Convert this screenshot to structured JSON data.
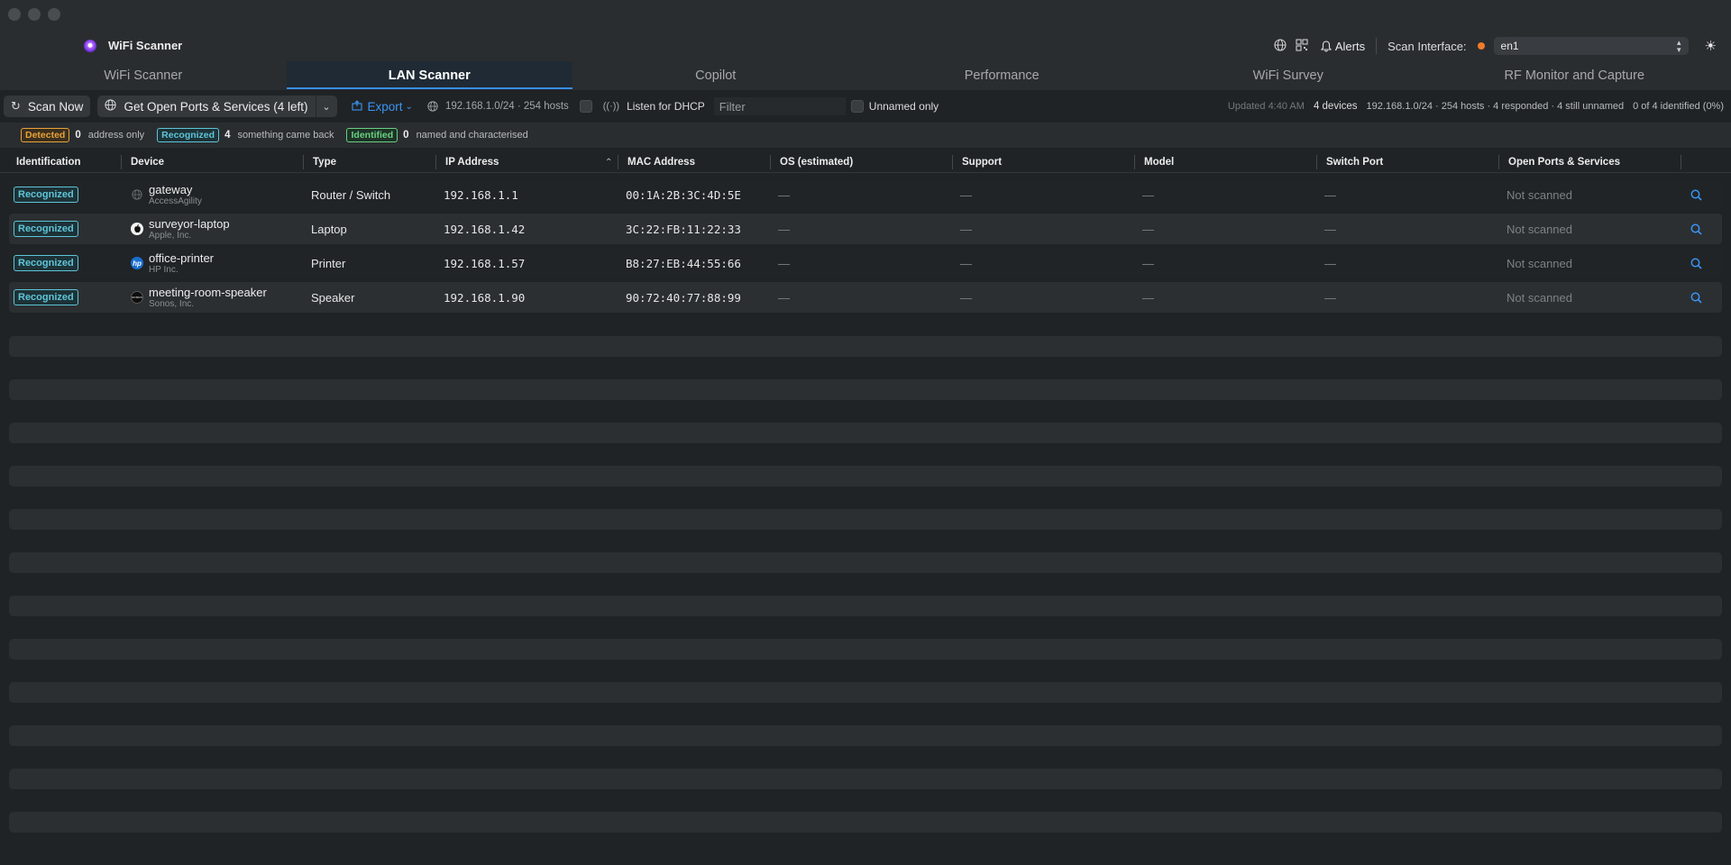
{
  "window": {
    "title": "WiFi Scanner"
  },
  "toolbar_right": {
    "alerts_label": "Alerts",
    "scan_interface_label": "Scan Interface:",
    "interface_value": "en1",
    "status_color": "#f07b2a"
  },
  "tabs": [
    {
      "label": "WiFi Scanner",
      "active": false
    },
    {
      "label": "LAN Scanner",
      "active": true
    },
    {
      "label": "Copilot",
      "active": false
    },
    {
      "label": "Performance",
      "active": false
    },
    {
      "label": "WiFi Survey",
      "active": false
    },
    {
      "label": "RF Monitor and Capture",
      "active": false
    }
  ],
  "toolbar": {
    "scan_now": "Scan Now",
    "open_ports": "Get Open Ports & Services (4 left)",
    "export": "Export",
    "network": "192.168.1.0/24 · 254 hosts",
    "listen_dhcp": "Listen for DHCP",
    "filter_placeholder": "Filter",
    "unnamed_only": "Unnamed only",
    "updated": "Updated 4:40 AM",
    "devices": "4 devices",
    "summary": "192.168.1.0/24 · 254 hosts · 4 responded · 4 still unnamed",
    "identified_ratio": "0 of 4 identified (0%)"
  },
  "legend": [
    {
      "badge": "Detected",
      "count": "0",
      "desc": "address only"
    },
    {
      "badge": "Recognized",
      "count": "4",
      "desc": "something came back"
    },
    {
      "badge": "Identified",
      "count": "0",
      "desc": "named and characterised"
    }
  ],
  "columns": [
    "Identification",
    "Device",
    "Type",
    "IP Address",
    "MAC Address",
    "OS (estimated)",
    "Support",
    "Model",
    "Switch Port",
    "Open Ports & Services"
  ],
  "rows": [
    {
      "identification": "Recognized",
      "device": "gateway",
      "vendor": "AccessAgility",
      "icon": "globe-icon",
      "type": "Router / Switch",
      "ip": "192.168.1.1",
      "mac": "00:1A:2B:3C:4D:5E",
      "os": "—",
      "support": "—",
      "model": "—",
      "switch_port": "—",
      "ports": "Not scanned"
    },
    {
      "identification": "Recognized",
      "device": "surveyor-laptop",
      "vendor": "Apple, Inc.",
      "icon": "apple-icon",
      "type": "Laptop",
      "ip": "192.168.1.42",
      "mac": "3C:22:FB:11:22:33",
      "os": "—",
      "support": "—",
      "model": "—",
      "switch_port": "—",
      "ports": "Not scanned"
    },
    {
      "identification": "Recognized",
      "device": "office-printer",
      "vendor": "HP Inc.",
      "icon": "hp-logo-icon",
      "type": "Printer",
      "ip": "192.168.1.57",
      "mac": "B8:27:EB:44:55:66",
      "os": "—",
      "support": "—",
      "model": "—",
      "switch_port": "—",
      "ports": "Not scanned"
    },
    {
      "identification": "Recognized",
      "device": "meeting-room-speaker",
      "vendor": "Sonos, Inc.",
      "icon": "sonos-logo-icon",
      "type": "Speaker",
      "ip": "192.168.1.90",
      "mac": "90:72:40:77:88:99",
      "os": "—",
      "support": "—",
      "model": "—",
      "switch_port": "—",
      "ports": "Not scanned"
    }
  ]
}
